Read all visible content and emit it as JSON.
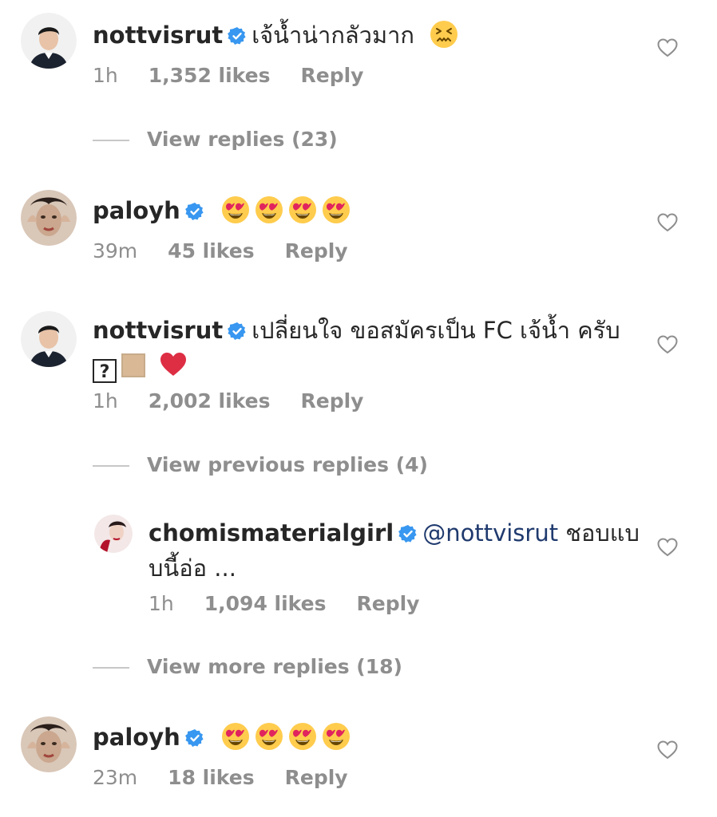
{
  "comments": [
    {
      "username": "nottvisrut",
      "text": "เจ้น้ำน่ากลัวมาก",
      "emojis": [
        "confounded"
      ],
      "time": "1h",
      "likes": "1,352 likes",
      "reply": "Reply"
    },
    {
      "username": "paloyh",
      "text": "",
      "emojis": [
        "heart-eyes",
        "heart-eyes",
        "heart-eyes",
        "heart-eyes"
      ],
      "time": "39m",
      "likes": "45 likes",
      "reply": "Reply"
    },
    {
      "username": "nottvisrut",
      "text": "เปลี่ยนใจ ขอสมัครเป็น FC เจ้น้ำ ครับ",
      "line2_symbols": [
        "?",
        "tan-box",
        "red-heart"
      ],
      "time": "1h",
      "likes": "2,002 likes",
      "reply": "Reply"
    },
    {
      "username": "chomismaterialgirl",
      "mention": "@nottvisrut",
      "text": "ชอบแบ",
      "text_line2": "บนี้อ่อ ...",
      "time": "1h",
      "likes": "1,094 likes",
      "reply": "Reply"
    },
    {
      "username": "paloyh",
      "text": "",
      "emojis": [
        "heart-eyes",
        "heart-eyes",
        "heart-eyes",
        "heart-eyes"
      ],
      "time": "23m",
      "likes": "18 likes",
      "reply": "Reply"
    }
  ],
  "view_replies": [
    "View replies (23)",
    "View previous replies (4)",
    "View more replies (18)"
  ],
  "colors": {
    "verified": "#3897f0",
    "muted": "#8e8e8e",
    "text": "#262626",
    "mention": "#1f3a6e"
  }
}
